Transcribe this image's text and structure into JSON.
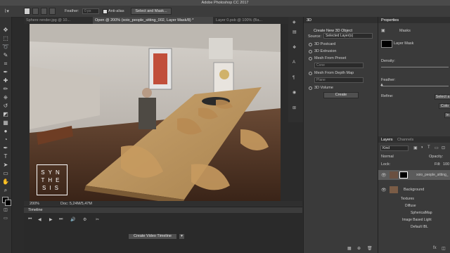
{
  "app_title": "Adobe Photoshop CC 2017",
  "options": {
    "feather_label": "Feather:",
    "feather_value": "0 px",
    "antialias_label": "Anti-alias",
    "select_mask_label": "Select and Mask..."
  },
  "tabs": [
    {
      "label": "Sphere render.jpg @ 10..."
    },
    {
      "label": "Open @ 200% (xoio_people_sitting_002, Layer Mask/8) *"
    },
    {
      "label": "Layer 0.psb @ 100% (Ba..."
    }
  ],
  "canvas": {
    "logo_lines": [
      "SYN",
      "THE",
      "SIS"
    ]
  },
  "status": {
    "zoom": "200%",
    "doc": "Doc: 5,24M/5,47M"
  },
  "timeline": {
    "title": "Timeline",
    "create_label": "Create Video Timeline"
  },
  "panel3d": {
    "tab": "3D",
    "heading": "Create New 3D Object",
    "source_label": "Source:",
    "source_value": "Selected Layer(s)",
    "options": [
      {
        "label": "3D Postcard"
      },
      {
        "label": "3D Extrusion"
      },
      {
        "label": "Mesh From Preset"
      },
      {
        "label": "Mesh From Depth Map"
      },
      {
        "label": "3D Volume"
      }
    ],
    "preset_placeholder": "Cone",
    "depth_placeholder": "Plane",
    "create_label": "Create"
  },
  "properties": {
    "title": "Properties",
    "masks_label": "Masks",
    "layer_mask_label": "Layer Mask",
    "density_label": "Density:",
    "feather_label": "Feather:",
    "refine_label": "Refine:",
    "refine_btn1": "Select a",
    "refine_btn2": "Colo",
    "refine_btn3": "In"
  },
  "layers": {
    "tab_layers": "Layers",
    "tab_channels": "Channels",
    "kind_label": "Kind",
    "blend_mode": "Normal",
    "opacity_label": "Opacity:",
    "lock_label": "Lock:",
    "fill_label": "Fill:",
    "fill_value": "100",
    "items": [
      {
        "name": "xoio_people_sitting_"
      },
      {
        "name": "Background"
      }
    ],
    "sub_items": [
      {
        "name": "Textures"
      },
      {
        "name": "Diffuse"
      },
      {
        "name": "SphericalMap"
      },
      {
        "name": "Image Based Light"
      },
      {
        "name": "Default IBL"
      }
    ]
  }
}
